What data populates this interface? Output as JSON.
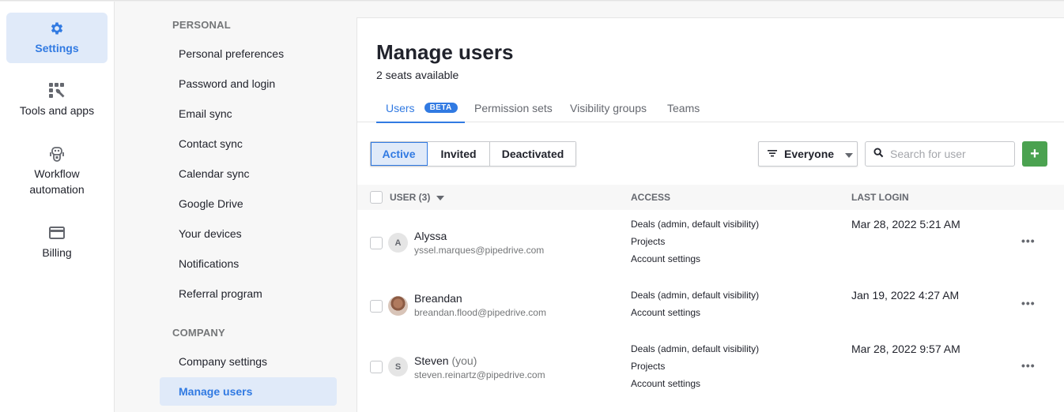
{
  "leftnav": {
    "items": [
      {
        "label": "Settings",
        "icon": "gear-icon",
        "active": true
      },
      {
        "label": "Tools and apps",
        "icon": "tools-icon",
        "active": false
      },
      {
        "label": "Workflow\nautomation",
        "icon": "robot-icon",
        "active": false
      },
      {
        "label": "Billing",
        "icon": "credit-card-icon",
        "active": false
      }
    ]
  },
  "settings_menu": {
    "personal_title": "PERSONAL",
    "personal_items": [
      "Personal preferences",
      "Password and login",
      "Email sync",
      "Contact sync",
      "Calendar sync",
      "Google Drive",
      "Your devices",
      "Notifications",
      "Referral program"
    ],
    "company_title": "COMPANY",
    "company_items": [
      "Company settings",
      "Manage users"
    ],
    "active_item": "Manage users"
  },
  "main": {
    "title": "Manage users",
    "seats": "2 seats available",
    "tabs": [
      {
        "label": "Users",
        "badge": "BETA",
        "active": true
      },
      {
        "label": "Permission sets"
      },
      {
        "label": "Visibility groups"
      },
      {
        "label": "Teams"
      }
    ],
    "status_filter": {
      "options": [
        "Active",
        "Invited",
        "Deactivated"
      ],
      "selected": "Active"
    },
    "group_filter": {
      "value": "Everyone"
    },
    "search": {
      "placeholder": "Search for user",
      "value": ""
    },
    "add_button": "+",
    "table": {
      "columns": {
        "user": "USER (3)",
        "access": "ACCESS",
        "last_login": "LAST LOGIN"
      },
      "rows": [
        {
          "initial": "A",
          "name": "Alyssa",
          "you": "",
          "email": "yssel.marques@pipedrive.com",
          "access": [
            "Deals (admin, default visibility)",
            "Projects",
            "Account settings"
          ],
          "last_login": "Mar 28, 2022 5:21 AM",
          "more": "•••"
        },
        {
          "initial": "",
          "name": "Breandan",
          "you": "",
          "email": "breandan.flood@pipedrive.com",
          "access": [
            "Deals (admin, default visibility)",
            "Account settings"
          ],
          "last_login": "Jan 19, 2022 4:27 AM",
          "more": "•••"
        },
        {
          "initial": "S",
          "name": "Steven",
          "you": "(you)",
          "email": "steven.reinartz@pipedrive.com",
          "access": [
            "Deals (admin, default visibility)",
            "Projects",
            "Account settings"
          ],
          "last_login": "Mar 28, 2022 9:57 AM",
          "more": "•••"
        }
      ]
    }
  },
  "colors": {
    "accent": "#317ae2",
    "active_bg": "#e0eaf9",
    "add_green": "#4ba250"
  }
}
